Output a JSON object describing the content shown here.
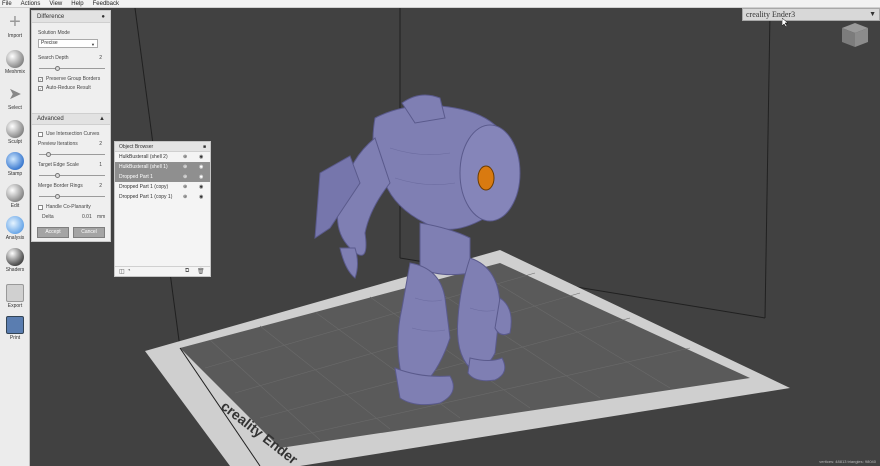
{
  "menu": [
    "File",
    "Actions",
    "View",
    "Help",
    "Feedback"
  ],
  "tools": [
    {
      "label": "Import",
      "icon": "plus-icon"
    },
    {
      "label": "Meshmix",
      "icon": "meshmix-icon"
    },
    {
      "label": "Select",
      "icon": "arrow-icon"
    },
    {
      "label": "Sculpt",
      "icon": "brush-icon"
    },
    {
      "label": "Stamp",
      "icon": "stamp-icon"
    },
    {
      "label": "Edit",
      "icon": "edit-icon"
    },
    {
      "label": "Analysis",
      "icon": "analysis-icon"
    },
    {
      "label": "Shaders",
      "icon": "shader-sphere-icon"
    },
    {
      "label": "Export",
      "icon": "export-icon"
    },
    {
      "label": "Print",
      "icon": "print-icon"
    }
  ],
  "panel": {
    "title": "Difference",
    "solution_mode_label": "Solution Mode",
    "solution_mode_value": "Precise",
    "search_depth_label": "Search Depth",
    "search_depth_value": "2",
    "preserve_group_borders": "Preserve Group Borders",
    "auto_reduce_result": "Auto-Reduce Result",
    "advanced_label": "Advanced",
    "use_intersection_curves": "Use Intersection Curves",
    "preview_iterations_label": "Preview Iterations",
    "preview_iterations_value": "2",
    "target_edge_scale_label": "Target Edge Scale",
    "target_edge_scale_value": "1",
    "merge_border_rings_label": "Merge Border Rings",
    "merge_border_rings_value": "2",
    "handle_coplanarity": "Handle Co-Planarity",
    "delta_label": "Delta",
    "delta_value": "0.01",
    "delta_unit": "mm",
    "accept_label": "Accept",
    "cancel_label": "Cancel",
    "sliders": {
      "search_depth": 0.25,
      "preview_iterations": 0.12,
      "target_edge_scale": 0.25,
      "merge_border_rings": 0.25
    }
  },
  "object_browser": {
    "title": "Object Browser",
    "items": [
      {
        "label": "HulkBusterall (shell 2)",
        "selected": false
      },
      {
        "label": "HulkBusterall (shell 1)",
        "selected": true
      },
      {
        "label": "Dropped Part 1",
        "selected": true
      },
      {
        "label": "Dropped Part 1 (copy)",
        "selected": false
      },
      {
        "label": "Dropped Part 1 (copy 1)",
        "selected": false
      }
    ]
  },
  "printer": {
    "value": "creality Ender3"
  },
  "bed_label": "creality Ender",
  "status_text": "vertices: 48813 triangles: 98040",
  "colors": {
    "model": "#7f7fb3",
    "bed": "#555555",
    "viewport": "#414141",
    "accent": "#e08a1a"
  }
}
